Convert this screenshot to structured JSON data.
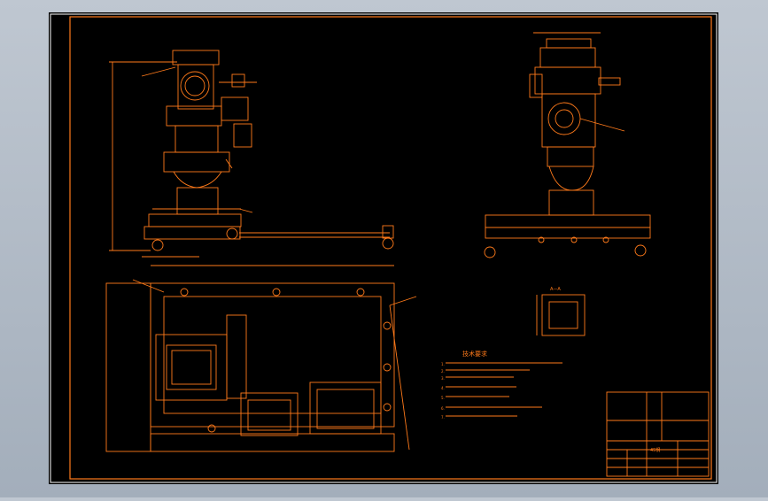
{
  "drawing": {
    "background_color": "#000000",
    "line_color": "#ff7a1a",
    "frame_color": "#ffffff",
    "viewer_background": "#b0bac6"
  },
  "notes": {
    "heading": "技术要求",
    "items": [
      "1.",
      "2.",
      "3.",
      "4.",
      "5.",
      "6.",
      "7."
    ]
  },
  "section_label": "A—A",
  "title_block": {
    "material": "45钢"
  }
}
